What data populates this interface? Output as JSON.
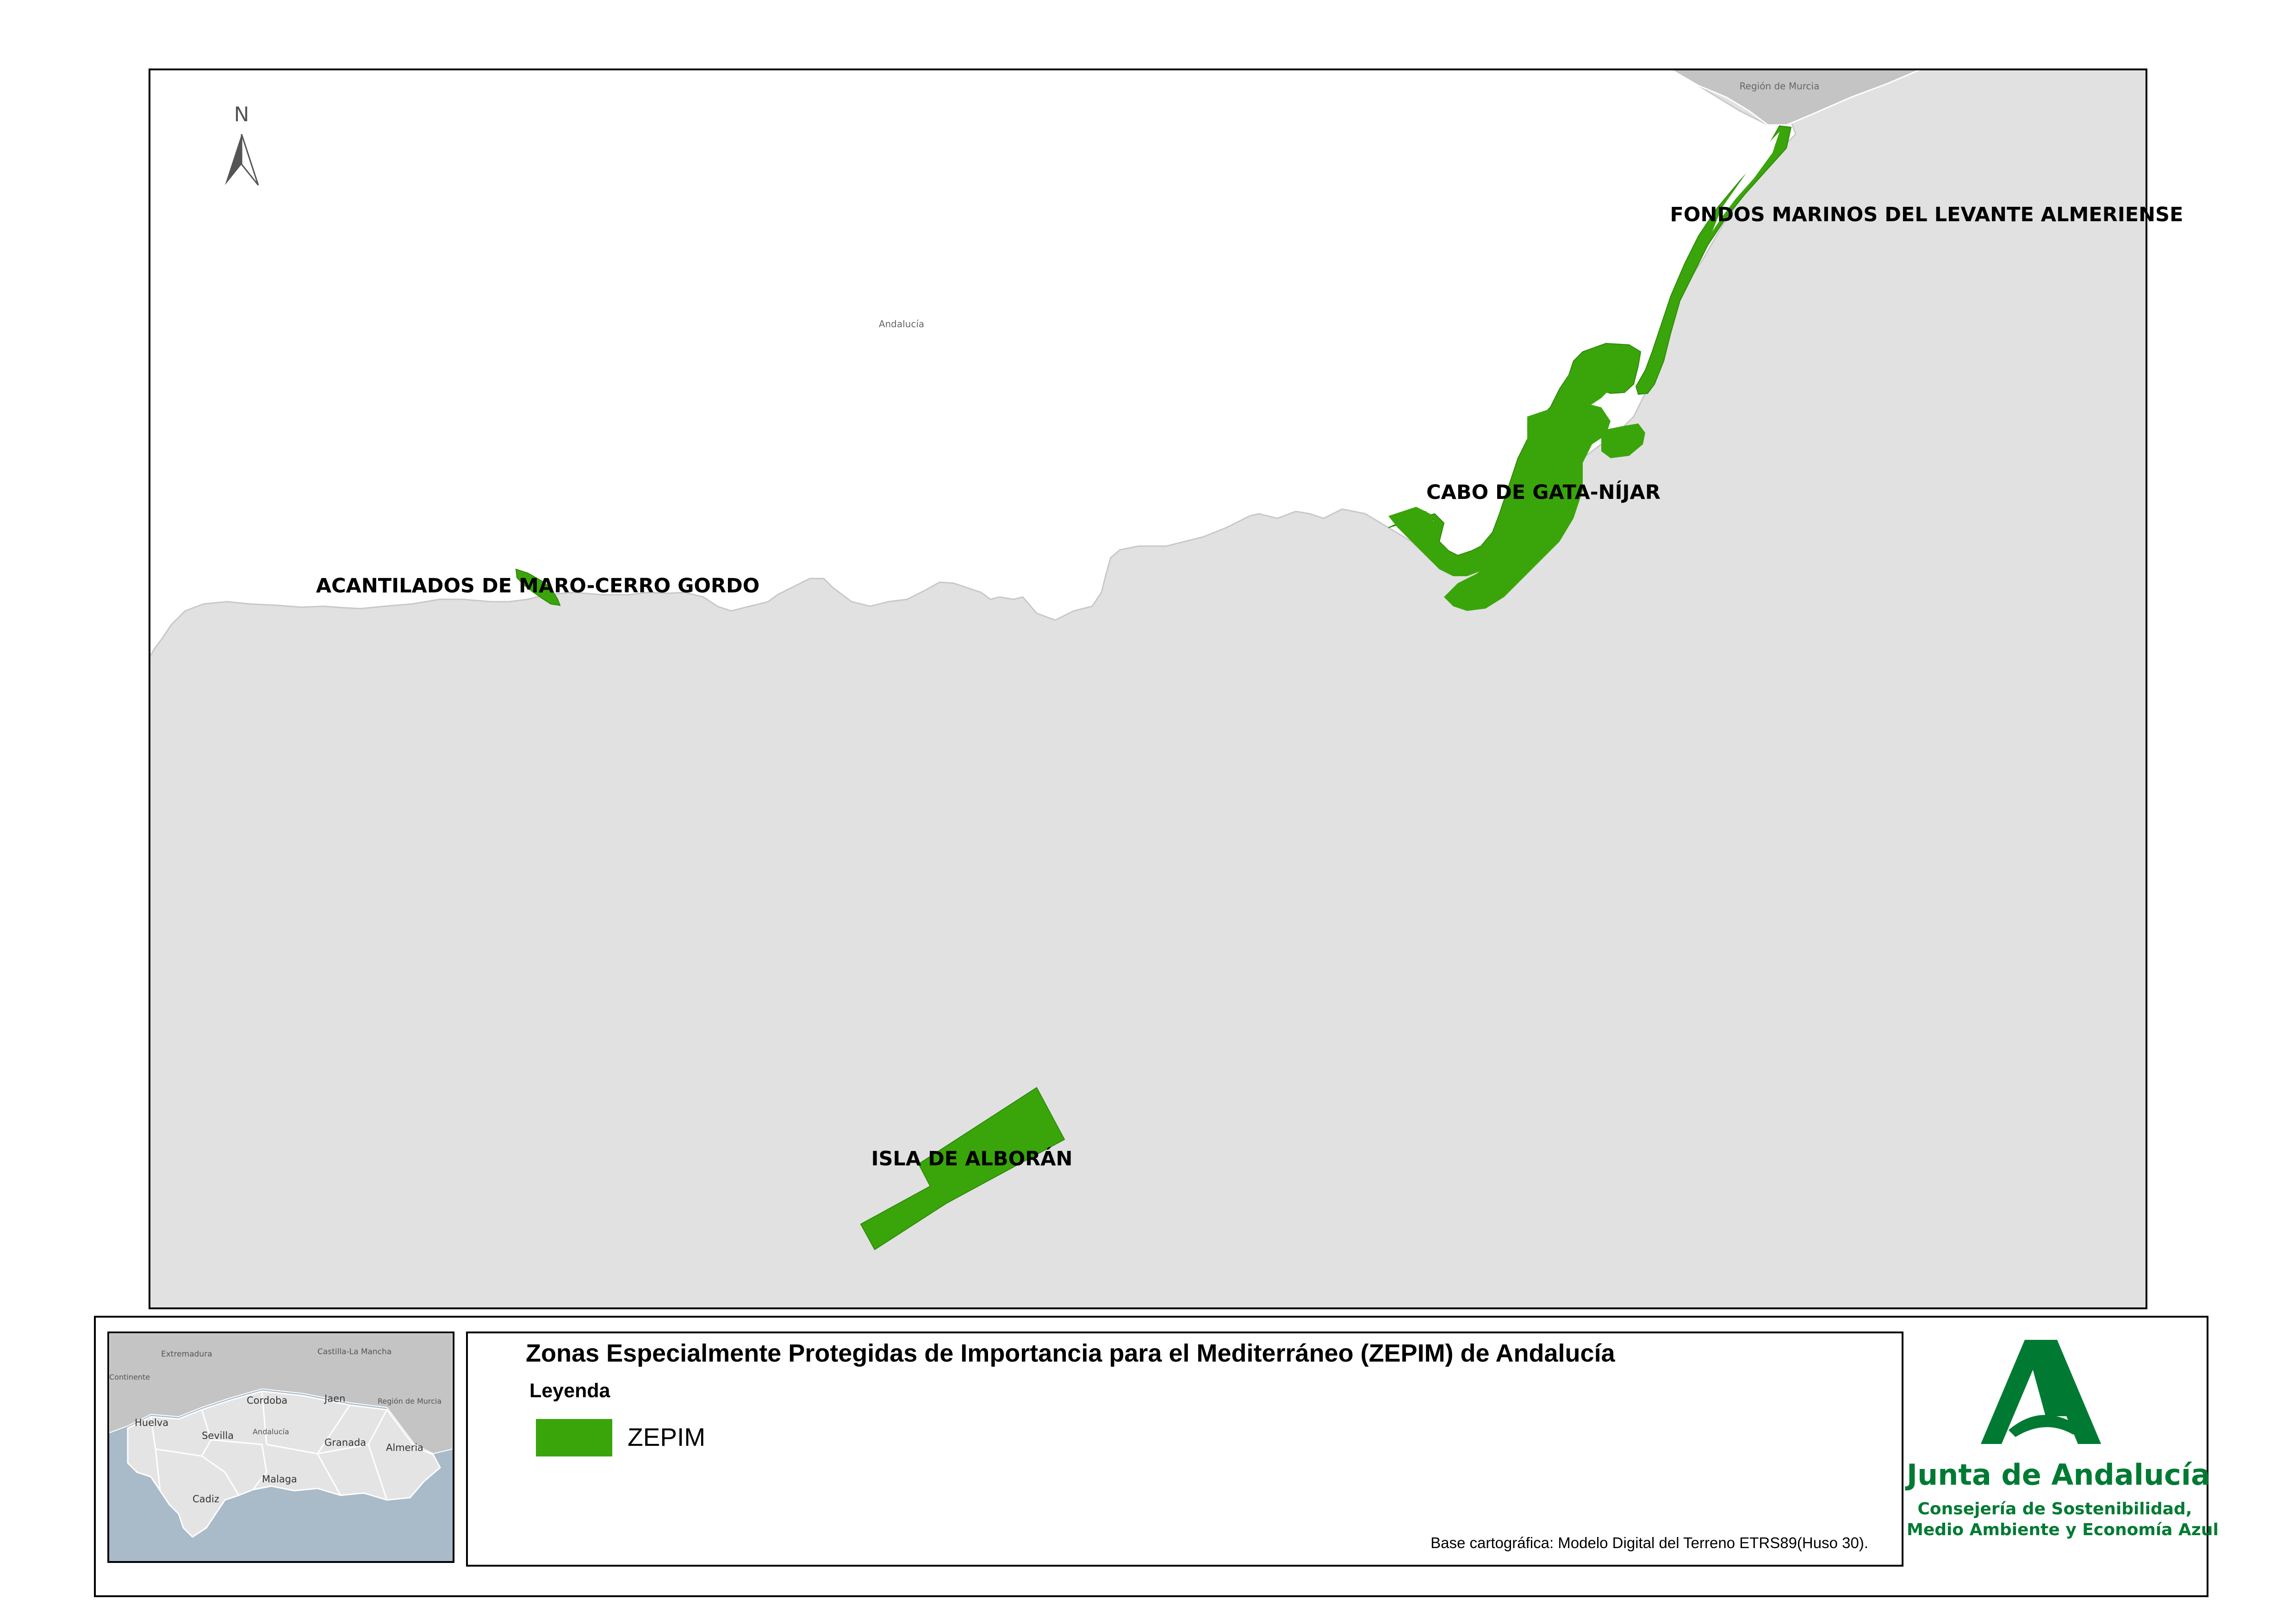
{
  "map": {
    "north_label": "N",
    "labels": {
      "region_murcia": "Región de Murcia",
      "andalucia": "Andalucía"
    },
    "zones": [
      {
        "id": "levante",
        "label": "FONDOS MARINOS DEL LEVANTE ALMERIENSE"
      },
      {
        "id": "cabo_gata",
        "label": "CABO DE GATA-NÍJAR"
      },
      {
        "id": "maro",
        "label": "ACANTILADOS DE MARO-CERRO GORDO"
      },
      {
        "id": "alboran",
        "label": "ISLA DE ALBORÁN"
      }
    ],
    "colors": {
      "zepim": "#3aa50a",
      "land": "#ffffff",
      "sea": "#e1e1e1",
      "inset_sea": "#a9bac9",
      "inset_land": "#e4e4e4",
      "neighbors": "#c4c4c4"
    }
  },
  "inset": {
    "regions": [
      "Extremadura",
      "Castilla-La Mancha",
      "Continente",
      "Huelva",
      "Cordoba",
      "Jaen",
      "Región de Murcia",
      "Sevilla",
      "Andalucía",
      "Granada",
      "Almeria",
      "Cadiz",
      "Malaga"
    ]
  },
  "legend": {
    "title": "Zonas Especialmente Protegidas de Importancia para el Mediterráneo (ZEPIM) de Andalucía",
    "heading": "Leyenda",
    "item": "ZEPIM",
    "source": "Base cartográfica: Modelo Digital del Terreno ETRS89(Huso 30)."
  },
  "logo": {
    "name": "Junta de Andalucía",
    "sub1": "Consejería de Sostenibilidad,",
    "sub2": "Medio Ambiente y Economía Azul",
    "color": "#007a33"
  }
}
